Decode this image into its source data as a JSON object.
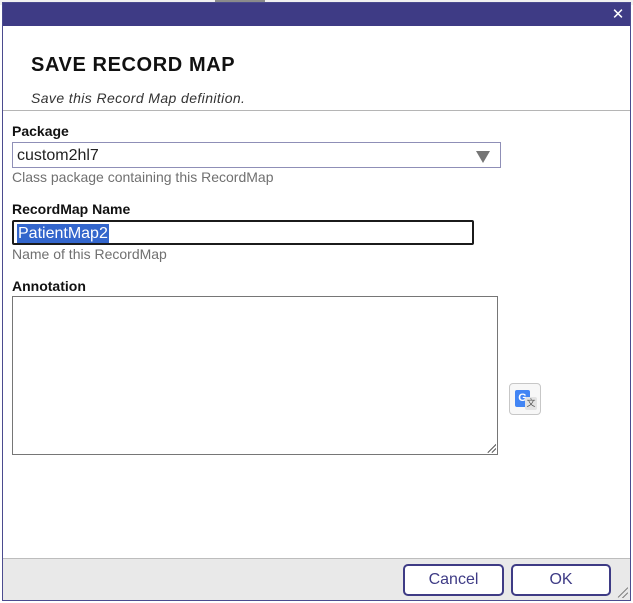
{
  "dialog": {
    "title": "SAVE RECORD MAP",
    "subtitle": "Save this Record Map definition.",
    "close_icon": "close-icon"
  },
  "form": {
    "package": {
      "label": "Package",
      "value": "custom2hl7",
      "hint": "Class package containing this RecordMap"
    },
    "recordmap_name": {
      "label": "RecordMap Name",
      "value": "PatientMap2",
      "hint": "Name of this RecordMap"
    },
    "annotation": {
      "label": "Annotation",
      "value": ""
    }
  },
  "translate_icon": {
    "icon": "google-translate-icon",
    "g": "G",
    "x": "文"
  },
  "footer": {
    "cancel_label": "Cancel",
    "ok_label": "OK"
  },
  "colors": {
    "titlebar": "#3e3b85",
    "selection": "#3366cc",
    "button_border": "#3e3b85",
    "footer_bg": "#e9e9e9"
  }
}
